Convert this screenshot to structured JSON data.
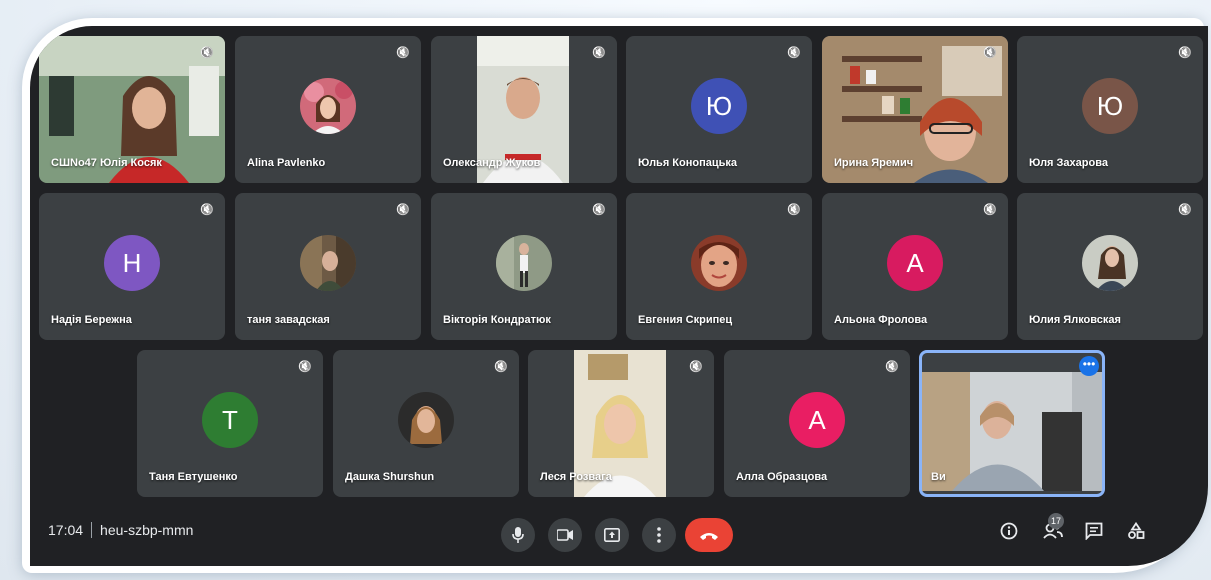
{
  "meeting": {
    "time": "17:04",
    "code": "heu-szbp-mmn",
    "participant_count": "17"
  },
  "participants": [
    {
      "name": "СШNo47 Юлія Косяк",
      "kind": "video"
    },
    {
      "name": "Alina Pavlenko",
      "kind": "photo"
    },
    {
      "name": "Олександр Жуков",
      "kind": "video"
    },
    {
      "name": "Юлья Конопацька",
      "kind": "letter",
      "letter": "Ю",
      "color": "#3f51b5"
    },
    {
      "name": "Ирина Яремич",
      "kind": "video"
    },
    {
      "name": "Юля Захарова",
      "kind": "letter",
      "letter": "Ю",
      "color": "#795548"
    },
    {
      "name": "Надія Бережна",
      "kind": "letter",
      "letter": "Н",
      "color": "#7e57c2"
    },
    {
      "name": "таня завадская",
      "kind": "photo"
    },
    {
      "name": "Вікторія Кондратюк",
      "kind": "photo"
    },
    {
      "name": "Евгения Скрипец",
      "kind": "photo"
    },
    {
      "name": "Альона Фролова",
      "kind": "letter",
      "letter": "А",
      "color": "#d81b60"
    },
    {
      "name": "Юлия Ялковская",
      "kind": "photo"
    },
    {
      "name": "Таня Евтушенко",
      "kind": "letter",
      "letter": "Т",
      "color": "#2e7d32"
    },
    {
      "name": "Дашка Shurshun",
      "kind": "photo"
    },
    {
      "name": "Леся Розвага",
      "kind": "video"
    },
    {
      "name": "Алла Образцова",
      "kind": "letter",
      "letter": "А",
      "color": "#e91e63"
    },
    {
      "name": "Ви",
      "kind": "video"
    }
  ],
  "icons": {
    "mic": "microphone-icon",
    "camera": "camera-icon",
    "present": "present-screen-icon",
    "more": "more-options-icon",
    "end": "end-call-icon",
    "info": "info-icon",
    "people": "people-icon",
    "chat": "chat-icon",
    "activities": "activities-icon"
  }
}
